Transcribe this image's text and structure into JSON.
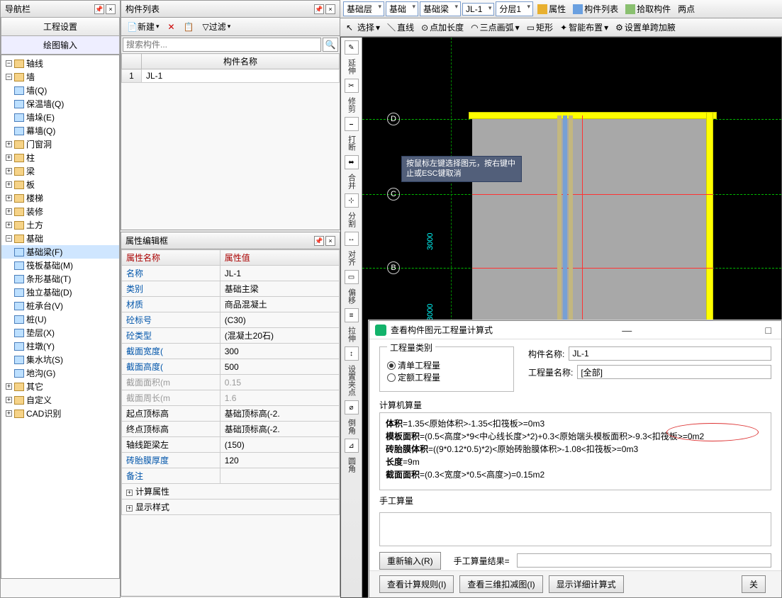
{
  "nav": {
    "title": "导航栏",
    "tabs": [
      "工程设置",
      "绘图输入"
    ],
    "tree": [
      {
        "t": "expand",
        "lvl": 0,
        "label": "轴线",
        "open": true,
        "folder": true
      },
      {
        "t": "expand",
        "lvl": 0,
        "label": "墙",
        "open": true,
        "folder": true
      },
      {
        "t": "leaf",
        "lvl": 1,
        "label": "墙(Q)"
      },
      {
        "t": "leaf",
        "lvl": 1,
        "label": "保温墙(Q)"
      },
      {
        "t": "leaf",
        "lvl": 1,
        "label": "墙垛(E)"
      },
      {
        "t": "leaf",
        "lvl": 1,
        "label": "幕墙(Q)"
      },
      {
        "t": "expand",
        "lvl": 0,
        "label": "门窗洞",
        "folder": true
      },
      {
        "t": "expand",
        "lvl": 0,
        "label": "柱",
        "folder": true
      },
      {
        "t": "expand",
        "lvl": 0,
        "label": "梁",
        "folder": true
      },
      {
        "t": "expand",
        "lvl": 0,
        "label": "板",
        "folder": true
      },
      {
        "t": "expand",
        "lvl": 0,
        "label": "楼梯",
        "folder": true
      },
      {
        "t": "expand",
        "lvl": 0,
        "label": "装修",
        "folder": true
      },
      {
        "t": "expand",
        "lvl": 0,
        "label": "土方",
        "folder": true
      },
      {
        "t": "expand",
        "lvl": 0,
        "label": "基础",
        "open": true,
        "folder": true
      },
      {
        "t": "leaf",
        "lvl": 1,
        "label": "基础梁(F)",
        "sel": true
      },
      {
        "t": "leaf",
        "lvl": 1,
        "label": "筏板基础(M)"
      },
      {
        "t": "leaf",
        "lvl": 1,
        "label": "条形基础(T)"
      },
      {
        "t": "leaf",
        "lvl": 1,
        "label": "独立基础(D)"
      },
      {
        "t": "leaf",
        "lvl": 1,
        "label": "桩承台(V)"
      },
      {
        "t": "leaf",
        "lvl": 1,
        "label": "桩(U)"
      },
      {
        "t": "leaf",
        "lvl": 1,
        "label": "垫层(X)"
      },
      {
        "t": "leaf",
        "lvl": 1,
        "label": "柱墩(Y)"
      },
      {
        "t": "leaf",
        "lvl": 1,
        "label": "集水坑(S)"
      },
      {
        "t": "leaf",
        "lvl": 1,
        "label": "地沟(G)"
      },
      {
        "t": "expand",
        "lvl": 0,
        "label": "其它",
        "folder": true
      },
      {
        "t": "expand",
        "lvl": 0,
        "label": "自定义",
        "folder": true
      },
      {
        "t": "expand",
        "lvl": 0,
        "label": "CAD识别",
        "folder": true
      }
    ]
  },
  "compList": {
    "title": "构件列表",
    "newLabel": "新建",
    "filterLabel": "过滤",
    "searchPlaceholder": "搜索构件...",
    "header": "构件名称",
    "rows": [
      {
        "n": "1",
        "name": "JL-1"
      }
    ]
  },
  "propEdit": {
    "title": "属性编辑框",
    "hName": "属性名称",
    "hVal": "属性值",
    "rows": [
      {
        "n": "名称",
        "v": "JL-1",
        "blue": true
      },
      {
        "n": "类别",
        "v": "基础主梁",
        "blue": true
      },
      {
        "n": "材质",
        "v": "商品混凝土",
        "blue": true
      },
      {
        "n": "砼标号",
        "v": "(C30)",
        "blue": true
      },
      {
        "n": "砼类型",
        "v": "(混凝土20石)",
        "blue": true
      },
      {
        "n": "截面宽度(",
        "v": "300",
        "blue": true
      },
      {
        "n": "截面高度(",
        "v": "500",
        "blue": true
      },
      {
        "n": "截面面积(m",
        "v": "0.15",
        "ro": true
      },
      {
        "n": "截面周长(m",
        "v": "1.6",
        "ro": true
      },
      {
        "n": "起点顶标高",
        "v": "基础顶标高(-2."
      },
      {
        "n": "终点顶标高",
        "v": "基础顶标高(-2."
      },
      {
        "n": "轴线距梁左",
        "v": "(150)"
      },
      {
        "n": "砖胎膜厚度",
        "v": "120",
        "blue": true
      },
      {
        "n": "备注",
        "v": "",
        "blue": true
      }
    ],
    "groups": [
      "计算属性",
      "显示样式"
    ]
  },
  "ribbon1": {
    "sel1": "基础层",
    "sel2": "基础",
    "sel3": "基础梁",
    "sel4": "JL-1",
    "sel5": "分层1",
    "b1": "属性",
    "b2": "构件列表",
    "b3": "拾取构件",
    "b4": "两点"
  },
  "ribbon2": {
    "b1": "选择",
    "b2": "直线",
    "b3": "点加长度",
    "b4": "三点画弧",
    "b5": "矩形",
    "b6": "智能布置",
    "b7": "设置单跨加腋"
  },
  "vtools": [
    "延伸",
    "修剪",
    "打断",
    "合并",
    "分割",
    "对齐",
    "偏移",
    "拉伸",
    "设置夹点",
    "倒角",
    "圆角"
  ],
  "hover": "按鼠标左键选择图元，按右键中止或ESC键取消",
  "axes": {
    "D": "D",
    "C": "C",
    "B": "B",
    "dim1": "3000",
    "dim2": "3000",
    "dimTop": "00"
  },
  "dlg": {
    "title": "查看构件图元工程量计算式",
    "grpLabel": "工程量类别",
    "rList": "清单工程量",
    "rQuota": "定额工程量",
    "nameLabel": "构件名称:",
    "nameVal": "JL-1",
    "qtyLabel": "工程量名称:",
    "qtyVal": "[全部]",
    "calcLabel": "计算机算量",
    "calc": [
      "体积=1.35<原始体积>-1.35<扣筏板>=0m3",
      "模板面积=(0.5<高度>*9<中心线长度>*2)+0.3<原始端头模板面积>-9.3<扣筏板>=0m2",
      "砖胎膜体积=((9*0.12*0.5)*2)<原始砖胎膜体积>-1.08<扣筏板>=0m3",
      "长度=9m",
      "截面面积=(0.3<宽度>*0.5<高度>)=0.15m2"
    ],
    "handLabel": "手工算量",
    "reinput": "重新输入(R)",
    "handRes": "手工算量结果=",
    "bt1": "查看计算规则(I)",
    "bt2": "查看三维扣减图(I)",
    "bt3": "显示详细计算式",
    "close": "关"
  }
}
